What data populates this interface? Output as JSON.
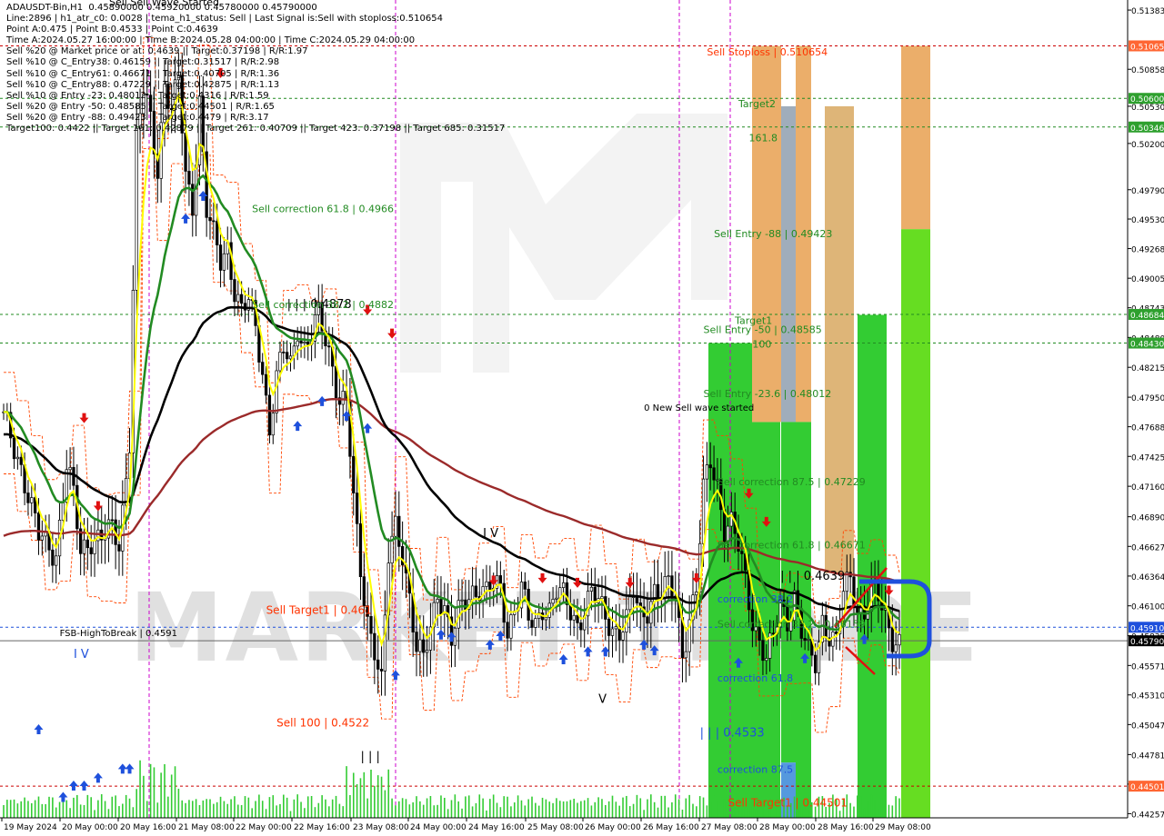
{
  "colors": {
    "background": "#ffffff",
    "candle": "#000000",
    "ma_yellow": "#ffff00",
    "ma_green": "#228b22",
    "ma_black": "#000000",
    "ma_red": "#9b2a2a",
    "dotted_red": "#ff4500",
    "level_green": "#228b22",
    "level_red": "#cc0000",
    "zone_green": "#33cc33",
    "zone_light_green": "#66dd22",
    "zone_orange": "#e8a050",
    "zone_tan": "#d8a860",
    "zone_gray": "#8899aa",
    "zone_blue": "#5599dd",
    "arrow_up": "#1e50dc",
    "arrow_down": "#e01010",
    "volume": "#33cc33",
    "current_price_bg": "#000000",
    "stoploss_bg": "#ff6633",
    "green_label_bg": "#2ea02e",
    "blue_label_bg": "#1e50dc"
  },
  "info_lines": [
    "ADAUSDT-Bin,H1  0.45890000 0.45920000 0.45780000 0.45790000",
    "Line:2896 | h1_atr_c0: 0.0028 | tema_h1_status: Sell | Last Signal is:Sell with stoploss:0.510654",
    "Point A:0.475 | Point B:0.4533 | Point C:0.4639",
    "Time A:2024.05.27 16:00:00 | Time B:2024.05.28 04:00:00 | Time C:2024.05.29 04:00:00",
    "Sell %20 @ Market price or at: 0.4639 || Target:0.37198 | R/R:1.97",
    "Sell %10 @ C_Entry38: 0.46159 || Target:0.31517 | R/R:2.98",
    "Sell %10 @ C_Entry61: 0.46671 || Target:0.40705 | R/R:1.36",
    "Sell %10 @ C_Entry88: 0.47229 || Target:0.42875 | R/R:1.13",
    "Sell %10 @ Entry -23: 0.48012 || Target:0.4316 | R/R:1.59",
    "Sell %20 @ Entry -50: 0.48585 || Target:0.44501 | R/R:1.65",
    "Sell %20 @ Entry -88: 0.49423 || Target:0.4479 | R/R:3.17",
    "Target100: 0.4422 || Target 161: 0.42879 || Target 261: 0.40709 || Target 423: 0.37198 || Target 685: 0.31517"
  ],
  "top_cut_text": "Sell Sell Wave Started",
  "price_axis": {
    "ticks": [
      "0.51383",
      "0.50858",
      "0.50530",
      "0.50200",
      "0.49790",
      "0.49530",
      "0.49268",
      "0.49005",
      "0.48743",
      "0.48480",
      "0.48215",
      "0.47950",
      "0.47688",
      "0.47425",
      "0.47160",
      "0.46890",
      "0.46627",
      "0.46364",
      "0.46100",
      "0.45835",
      "0.45571",
      "0.45310",
      "0.45047",
      "0.44781",
      "0.44519",
      "0.44257"
    ],
    "tick_values": [
      0.51383,
      0.50858,
      0.5053,
      0.502,
      0.4979,
      0.4953,
      0.49268,
      0.49005,
      0.48743,
      0.4848,
      0.48215,
      0.4795,
      0.47688,
      0.47425,
      0.4716,
      0.4689,
      0.46627,
      0.46364,
      0.461,
      0.45835,
      0.45571,
      0.4531,
      0.45047,
      0.44781,
      0.44519,
      0.44257
    ],
    "min": 0.4422,
    "max": 0.5144
  },
  "price_tags": [
    {
      "text": "0.51065",
      "value": 0.510654,
      "style": "stoploss"
    },
    {
      "text": "0.50600",
      "value": 0.506,
      "style": "green"
    },
    {
      "text": "0.50346",
      "value": 0.50346,
      "style": "green"
    },
    {
      "text": "0.48684",
      "value": 0.48684,
      "style": "green"
    },
    {
      "text": "0.48430",
      "value": 0.4843,
      "style": "green"
    },
    {
      "text": "0.45910",
      "value": 0.4591,
      "style": "blue"
    },
    {
      "text": "0.45790",
      "value": 0.4579,
      "style": "current"
    },
    {
      "text": "0.44501",
      "value": 0.44501,
      "style": "stoploss"
    }
  ],
  "time_axis": {
    "labels": [
      "19 May 2024",
      "20 May 00:00",
      "20 May 16:00",
      "21 May 08:00",
      "22 May 00:00",
      "22 May 16:00",
      "23 May 08:00",
      "24 May 00:00",
      "24 May 16:00",
      "25 May 08:00",
      "26 May 00:00",
      "26 May 16:00",
      "27 May 08:00",
      "28 May 00:00",
      "28 May 16:00",
      "29 May 08:00"
    ]
  },
  "levels": [
    {
      "value": 0.510654,
      "color": "red",
      "dash": "dash"
    },
    {
      "value": 0.506,
      "color": "green",
      "dash": "dash"
    },
    {
      "value": 0.50346,
      "color": "green",
      "dash": "dash"
    },
    {
      "value": 0.48684,
      "color": "green",
      "dash": "dash"
    },
    {
      "value": 0.4843,
      "color": "green",
      "dash": "dash"
    },
    {
      "value": 0.4591,
      "color": "blue",
      "dash": "dash"
    },
    {
      "value": 0.4579,
      "color": "gray",
      "dash": "solid"
    },
    {
      "value": 0.44501,
      "color": "red",
      "dash": "dash"
    }
  ],
  "annotations": [
    {
      "text": "Sell Stoploss | 0.510654",
      "price": 0.5098,
      "bar": 201,
      "color": "#ff3300",
      "size": 11
    },
    {
      "text": "Target2",
      "price": 0.5052,
      "bar": 210,
      "color": "#228b22",
      "size": 11
    },
    {
      "text": "161.8",
      "price": 0.5022,
      "bar": 213,
      "color": "#228b22",
      "size": 11
    },
    {
      "text": "Sell Entry -88 | 0.49423",
      "price": 0.4937,
      "bar": 203,
      "color": "#228b22",
      "size": 11
    },
    {
      "text": "Target1",
      "price": 0.486,
      "bar": 209,
      "color": "#228b22",
      "size": 11
    },
    {
      "text": "Sell Entry -50 | 0.48585",
      "price": 0.4852,
      "bar": 200,
      "color": "#228b22",
      "size": 11
    },
    {
      "text": "100",
      "price": 0.4839,
      "bar": 214,
      "color": "#228b22",
      "size": 11
    },
    {
      "text": "Sell Entry -23.6 | 0.48012",
      "price": 0.4795,
      "bar": 200,
      "color": "#228b22",
      "size": 11
    },
    {
      "text": "0 New Sell wave started",
      "price": 0.4783,
      "bar": 183,
      "color": "#000000",
      "size": 10
    },
    {
      "text": "Sell correction 61.8 | 0.4966",
      "price": 0.4959,
      "bar": 71,
      "color": "#228b22",
      "size": 11
    },
    {
      "text": "| | | 0.4878",
      "price": 0.4874,
      "bar": 81,
      "color": "#000000",
      "size": 13
    },
    {
      "text": "Sell correction 38.2 | 0.4882",
      "price": 0.4874,
      "bar": 71,
      "color": "#228b22",
      "size": 11
    },
    {
      "text": "Sell correction 87.5 | 0.47229",
      "price": 0.4717,
      "bar": 204,
      "color": "#228b22",
      "size": 11
    },
    {
      "text": "| | | 0.4639",
      "price": 0.4633,
      "bar": 222,
      "color": "#000000",
      "size": 13
    },
    {
      "text": "Sell correction 61.8 | 0.46671",
      "price": 0.4661,
      "bar": 204,
      "color": "#228b22",
      "size": 11
    },
    {
      "text": "correction 38.2",
      "price": 0.4613,
      "bar": 204,
      "color": "#1e50dc",
      "size": 11
    },
    {
      "text": "Sell correction 38.2 | 0.46159",
      "price": 0.4591,
      "bar": 204,
      "color": "#228b22",
      "size": 11
    },
    {
      "text": "I V",
      "price": 0.4671,
      "bar": 137,
      "color": "#000000",
      "size": 13
    },
    {
      "text": "Sell Target1 | 0.461",
      "price": 0.4603,
      "bar": 75,
      "color": "#ff3300",
      "size": 12
    },
    {
      "text": "FSB-HighToBreak | 0.4591",
      "price": 0.4583,
      "bar": 16,
      "color": "#000000",
      "size": 10
    },
    {
      "text": "I V",
      "price": 0.4564,
      "bar": 20,
      "color": "#1e50dc",
      "size": 13
    },
    {
      "text": "correction 61.8",
      "price": 0.4543,
      "bar": 204,
      "color": "#1e50dc",
      "size": 11
    },
    {
      "text": "V",
      "price": 0.4524,
      "bar": 170,
      "color": "#000000",
      "size": 13
    },
    {
      "text": "Sell 100 | 0.4522",
      "price": 0.4503,
      "bar": 78,
      "color": "#ff3300",
      "size": 12
    },
    {
      "text": "| | | 0.4533",
      "price": 0.4494,
      "bar": 199,
      "color": "#1e50dc",
      "size": 13
    },
    {
      "text": "| | |",
      "price": 0.4473,
      "bar": 102,
      "color": "#000000",
      "size": 13
    },
    {
      "text": "correction 87.5",
      "price": 0.4462,
      "bar": 204,
      "color": "#1e50dc",
      "size": 11
    },
    {
      "text": "Sell Target1 | 0.44501",
      "price": 0.4432,
      "bar": 207,
      "color": "#ff3300",
      "size": 12
    }
  ],
  "watermark": "MARKET TRADE",
  "chart_data": {
    "type": "candlestick",
    "title": "ADAUSDT-Bin,H1",
    "timeframe": "H1",
    "symbol": "ADAUSDT-Bin",
    "last_ohlc": {
      "open": 0.4589,
      "high": 0.4592,
      "low": 0.4578,
      "close": 0.4579
    },
    "ylim": [
      0.4422,
      0.5144
    ],
    "anchors": [
      [
        0,
        0.4775
      ],
      [
        5,
        0.4735
      ],
      [
        10,
        0.467
      ],
      [
        15,
        0.4658
      ],
      [
        18,
        0.4735
      ],
      [
        20,
        0.4705
      ],
      [
        22,
        0.4657
      ],
      [
        25,
        0.4672
      ],
      [
        28,
        0.467
      ],
      [
        31,
        0.4675
      ],
      [
        33,
        0.4665
      ],
      [
        36,
        0.476
      ],
      [
        38,
        0.5022
      ],
      [
        40,
        0.5065
      ],
      [
        42,
        0.504
      ],
      [
        44,
        0.5
      ],
      [
        46,
        0.5075
      ],
      [
        48,
        0.5048
      ],
      [
        50,
        0.5075
      ],
      [
        52,
        0.499
      ],
      [
        54,
        0.4968
      ],
      [
        56,
        0.506
      ],
      [
        58,
        0.496
      ],
      [
        60,
        0.4935
      ],
      [
        62,
        0.4915
      ],
      [
        64,
        0.493
      ],
      [
        66,
        0.4892
      ],
      [
        68,
        0.487
      ],
      [
        70,
        0.4878
      ],
      [
        72,
        0.4856
      ],
      [
        74,
        0.482
      ],
      [
        76,
        0.477
      ],
      [
        78,
        0.481
      ],
      [
        80,
        0.4835
      ],
      [
        82,
        0.4822
      ],
      [
        84,
        0.486
      ],
      [
        86,
        0.484
      ],
      [
        88,
        0.485
      ],
      [
        90,
        0.4865
      ],
      [
        92,
        0.4845
      ],
      [
        94,
        0.4825
      ],
      [
        96,
        0.4795
      ],
      [
        98,
        0.479
      ],
      [
        100,
        0.47
      ],
      [
        102,
        0.464
      ],
      [
        104,
        0.46
      ],
      [
        106,
        0.4575
      ],
      [
        108,
        0.454
      ],
      [
        110,
        0.465
      ],
      [
        112,
        0.468
      ],
      [
        114,
        0.466
      ],
      [
        116,
        0.462
      ],
      [
        118,
        0.457
      ],
      [
        120,
        0.456
      ],
      [
        122,
        0.459
      ],
      [
        124,
        0.4625
      ],
      [
        126,
        0.461
      ],
      [
        128,
        0.4578
      ],
      [
        130,
        0.46
      ],
      [
        132,
        0.4615
      ],
      [
        134,
        0.4625
      ],
      [
        136,
        0.4628
      ],
      [
        138,
        0.462
      ],
      [
        140,
        0.4625
      ],
      [
        142,
        0.4625
      ],
      [
        144,
        0.459
      ],
      [
        146,
        0.461
      ],
      [
        148,
        0.4625
      ],
      [
        150,
        0.4595
      ],
      [
        152,
        0.4592
      ],
      [
        154,
        0.4612
      ],
      [
        156,
        0.4608
      ],
      [
        158,
        0.4622
      ],
      [
        160,
        0.4615
      ],
      [
        162,
        0.4605
      ],
      [
        164,
        0.4595
      ],
      [
        166,
        0.461
      ],
      [
        168,
        0.462
      ],
      [
        170,
        0.461
      ],
      [
        172,
        0.46
      ],
      [
        174,
        0.4592
      ],
      [
        176,
        0.459
      ],
      [
        178,
        0.4595
      ],
      [
        180,
        0.462
      ],
      [
        182,
        0.46
      ],
      [
        184,
        0.461
      ],
      [
        186,
        0.4625
      ],
      [
        188,
        0.462
      ],
      [
        190,
        0.4625
      ],
      [
        192,
        0.462
      ],
      [
        194,
        0.457
      ],
      [
        196,
        0.46
      ],
      [
        198,
        0.4622
      ],
      [
        200,
        0.471
      ],
      [
        202,
        0.474
      ],
      [
        204,
        0.472
      ],
      [
        206,
        0.468
      ],
      [
        208,
        0.468
      ],
      [
        210,
        0.466
      ],
      [
        212,
        0.4635
      ],
      [
        214,
        0.46
      ],
      [
        216,
        0.458
      ],
      [
        218,
        0.456
      ],
      [
        220,
        0.458
      ],
      [
        222,
        0.4612
      ],
      [
        224,
        0.46
      ],
      [
        226,
        0.462
      ],
      [
        228,
        0.4585
      ],
      [
        230,
        0.4565
      ],
      [
        232,
        0.456
      ],
      [
        234,
        0.46
      ],
      [
        236,
        0.4585
      ],
      [
        238,
        0.4575
      ],
      [
        240,
        0.462
      ],
      [
        242,
        0.4635
      ],
      [
        244,
        0.461
      ],
      [
        246,
        0.4605
      ],
      [
        248,
        0.462
      ],
      [
        250,
        0.4615
      ],
      [
        252,
        0.46
      ],
      [
        254,
        0.4585
      ],
      [
        256,
        0.4579
      ]
    ]
  }
}
